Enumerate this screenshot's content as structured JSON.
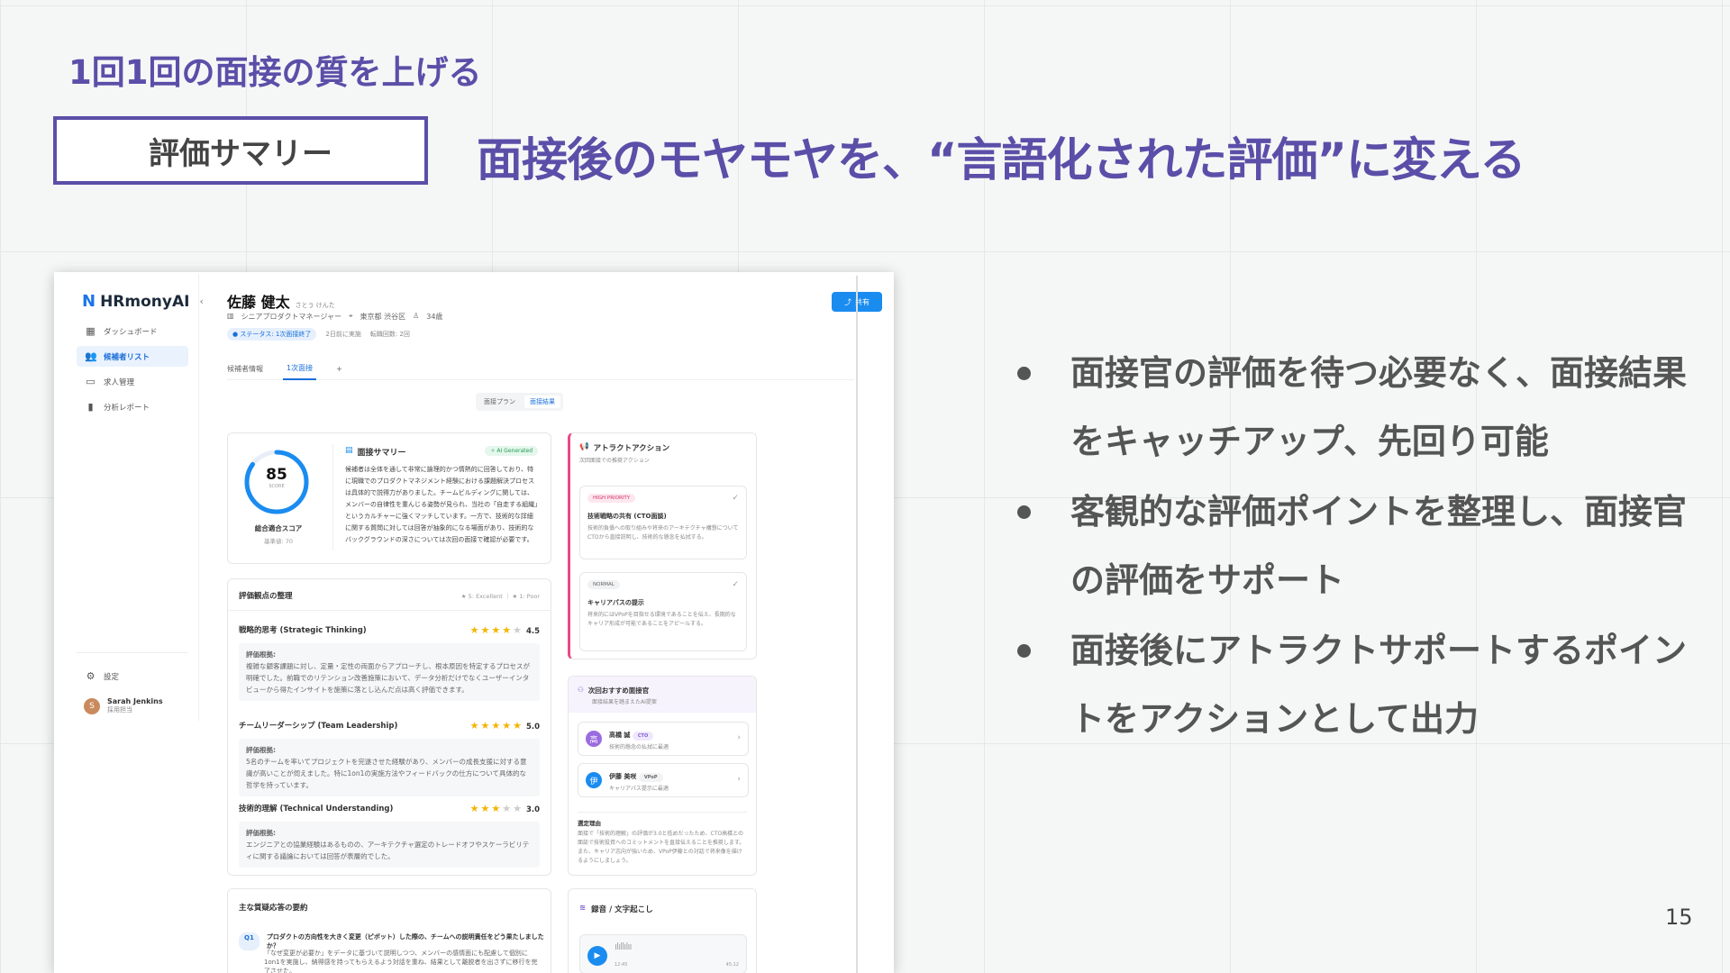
{
  "slide": {
    "eyebrow": "1回1回の面接の質を上げる",
    "tag": "評価サマリー",
    "headline": "面接後のモヤモヤを、“言語化された評価”に変える",
    "bullets": [
      "面接官の評価を待つ必要なく、面接結果をキャッチアップ、先回り可能",
      "客観的な評価ポイントを整理し、面接官の評価をサポート",
      "面接後にアトラクトサポートするポイントをアクションとして出力"
    ],
    "page": "15"
  },
  "app": {
    "name": "HRmonyAI",
    "nav": [
      "ダッシュボード",
      "候補者リスト",
      "求人管理",
      "分析レポート"
    ],
    "settings": "設定",
    "user": {
      "name": "Sarah Jenkins",
      "role": "採用担当"
    }
  },
  "candidate": {
    "name": "佐藤 健太",
    "kana": "さとう けんた",
    "position": "シニアプロダクトマネージャー",
    "location": "東京都 渋谷区",
    "age": "34歳",
    "status": "● ステータス: 1次面接終了",
    "date": "2日前に実施",
    "changes": "転職回数: 2回",
    "share": "共有"
  },
  "tabs": [
    "候補者情報",
    "1次面接"
  ],
  "toggle": [
    "面接プラン",
    "面接結果"
  ],
  "summary": {
    "score": "85",
    "score_ring_fraction": 0.85,
    "score_label": "SCORE",
    "score_title": "総合適合スコア",
    "baseline": "基準値: 70",
    "title": "面接サマリー",
    "badge": "✧ AI Generated",
    "text": "候補者は全体を通して非常に論理的かつ情熱的に回答しており、特に現職でのプロダクトマネジメント経験における課題解決プロセスは具体的で説得力がありました。チームビルディングに関しては、メンバーの自律性を重んじる姿勢が見られ、当社の「自走する組織」というカルチャーに強くマッチしています。一方で、技術的な詳細に関する質問に対しては回答が抽象的になる場面があり、技術的なバックグラウンドの深さについては次回の面接で確認が必要です。"
  },
  "evaluation": {
    "title": "評価観点の整理",
    "legend": "★ 5: Excellent ｜ ★ 1: Poor",
    "label": "評価根拠:",
    "items": [
      {
        "name": "戦略的思考 (Strategic Thinking)",
        "score": "4.5",
        "comment": "複雑な顧客課題に対し、定量・定性の両面からアプローチし、根本原因を特定するプロセスが明確でした。前職でのリテンション改善施策において、データ分析だけでなくユーザーインタビューから得たインサイトを施策に落とし込んだ点は高く評価できます。"
      },
      {
        "name": "チームリーダーシップ (Team Leadership)",
        "score": "5.0",
        "comment": "5名のチームを率いてプロジェクトを完遂させた経験があり、メンバーの成長支援に対する意識が高いことが伺えました。特に1on1の実施方法やフィードバックの仕方について具体的な哲学を持っています。"
      },
      {
        "name": "技術的理解 (Technical Understanding)",
        "score": "3.0",
        "comment": "エンジニアとの協業経験はあるものの、アーキテクチャ選定のトレードオフやスケーラビリティに関する議論においては回答が表層的でした。"
      }
    ]
  },
  "qa": {
    "title": "主な質疑応答の要約",
    "q_label": "Q1",
    "question": "プロダクトの方向性を大きく変更（ピボット）した際の、チームへの説明責任をどう果たしましたか？",
    "answer": "「なぜ変更が必要か」をデータに基づいて説明しつつ、メンバーの感情面にも配慮して個別に1on1を実施し、納得感を持ってもらえるよう対話を重ね、結果として離脱者を出さずに移行を完了させた。"
  },
  "attract": {
    "title": "アトラクトアクション",
    "subtitle": "次回面接での推奨アクション",
    "items": [
      {
        "priority": "HIGH PRIORITY",
        "title": "技術戦略の共有 (CTO面談)",
        "text": "技術的負債への取り組みや将来のアーキテクチャ構想についてCTOから直接説明し、技術的な懸念を払拭する。"
      },
      {
        "priority": "NORMAL",
        "title": "キャリアパスの提示",
        "text": "将来的にはVPoPを目指せる環境であることを伝え、長期的なキャリア形成が可能であることをアピールする。"
      }
    ]
  },
  "recommend": {
    "title": "次回おすすめ面接官",
    "subtitle": "面接結果を踏まえたAI提案",
    "people": [
      {
        "name": "高橋 誠",
        "role": "CTO",
        "note": "技術的懸念の払拭に最適"
      },
      {
        "name": "伊藤 美咲",
        "role": "VPoP",
        "note": "キャリアパス提示に最適"
      }
    ],
    "reason_title": "選定理由",
    "reason": "面接で「技術的理解」の評価が3.0と低めだったため、CTO高橋との面談で技術投資へのコミットメントを直接伝えることを推奨します。また、キャリア志向が強いため、VPoP伊藤との対話で将来像を描けるようにしましょう。"
  },
  "recording": {
    "title": "録音 / 文字起こし",
    "current": "12:45",
    "total": "45:12"
  }
}
